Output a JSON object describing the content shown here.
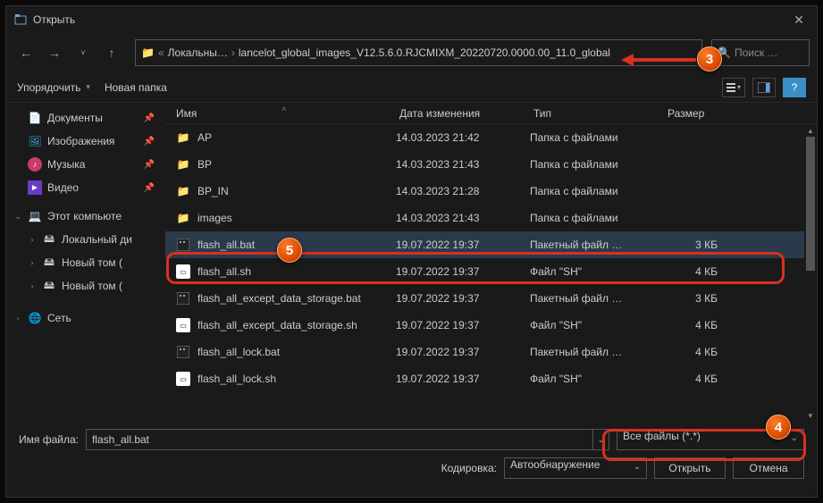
{
  "title": "Открыть",
  "breadcrumb": {
    "part1": "Локальны…",
    "part2": "lancelot_global_images_V12.5.6.0.RJCMIXM_20220720.0000.00_11.0_global"
  },
  "search_placeholder": "Поиск …",
  "toolbar": {
    "organize": "Упорядочить",
    "newfolder": "Новая папка"
  },
  "sidebar": {
    "docs": "Документы",
    "imgs": "Изображения",
    "mus": "Музыка",
    "vid": "Видео",
    "pc": "Этот компьюте",
    "localdrv": "Локальный ди",
    "newvol1": "Новый том (",
    "newvol2": "Новый том (",
    "network": "Сеть"
  },
  "cols": {
    "name": "Имя",
    "date": "Дата изменения",
    "type": "Тип",
    "size": "Размер"
  },
  "files": [
    {
      "icon": "folder",
      "name": "AP",
      "date": "14.03.2023 21:42",
      "type": "Папка с файлами",
      "size": ""
    },
    {
      "icon": "folder",
      "name": "BP",
      "date": "14.03.2023 21:43",
      "type": "Папка с файлами",
      "size": ""
    },
    {
      "icon": "folder",
      "name": "BP_IN",
      "date": "14.03.2023 21:28",
      "type": "Папка с файлами",
      "size": ""
    },
    {
      "icon": "folder",
      "name": "images",
      "date": "14.03.2023 21:43",
      "type": "Папка с файлами",
      "size": ""
    },
    {
      "icon": "bat",
      "name": "flash_all.bat",
      "date": "19.07.2022 19:37",
      "type": "Пакетный файл …",
      "size": "3 КБ"
    },
    {
      "icon": "sh",
      "name": "flash_all.sh",
      "date": "19.07.2022 19:37",
      "type": "Файл \"SH\"",
      "size": "4 КБ"
    },
    {
      "icon": "bat",
      "name": "flash_all_except_data_storage.bat",
      "date": "19.07.2022 19:37",
      "type": "Пакетный файл …",
      "size": "3 КБ"
    },
    {
      "icon": "sh",
      "name": "flash_all_except_data_storage.sh",
      "date": "19.07.2022 19:37",
      "type": "Файл \"SH\"",
      "size": "4 КБ"
    },
    {
      "icon": "bat",
      "name": "flash_all_lock.bat",
      "date": "19.07.2022 19:37",
      "type": "Пакетный файл …",
      "size": "4 КБ"
    },
    {
      "icon": "sh",
      "name": "flash_all_lock.sh",
      "date": "19.07.2022 19:37",
      "type": "Файл \"SH\"",
      "size": "4 КБ"
    }
  ],
  "bottom": {
    "filename_label": "Имя файла:",
    "filename_value": "flash_all.bat",
    "encoding_label": "Кодировка:",
    "encoding_value": "Автообнаружение",
    "filter": "Все файлы  (*.*)",
    "open": "Открыть",
    "cancel": "Отмена"
  },
  "anno": {
    "n3": "3",
    "n4": "4",
    "n5": "5"
  }
}
